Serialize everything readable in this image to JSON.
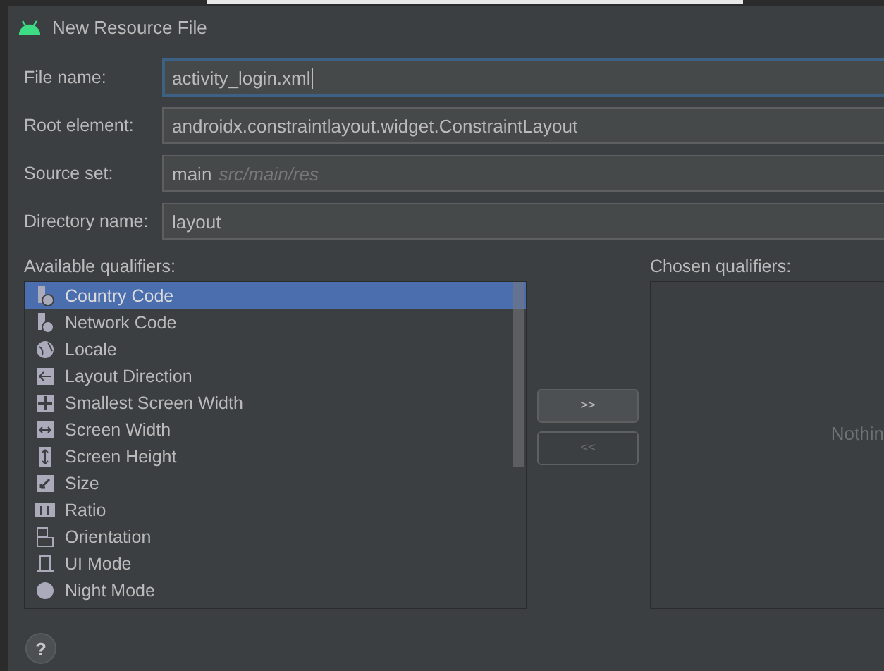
{
  "window": {
    "title": "New Resource File"
  },
  "fields": [
    {
      "label": "File name:",
      "value": "activity_login.xml",
      "focused": true
    },
    {
      "label": "Root element:",
      "value": "androidx.constraintlayout.widget.ConstraintLayout",
      "focused": false
    },
    {
      "label": "Source set:",
      "value": "main",
      "hint": "src/main/res",
      "focused": false
    },
    {
      "label": "Directory name:",
      "value": "layout",
      "focused": false
    }
  ],
  "available": {
    "label": "Available qualifiers:",
    "items": [
      {
        "label": "Country Code",
        "selected": true
      },
      {
        "label": "Network Code",
        "selected": false
      },
      {
        "label": "Locale",
        "selected": false
      },
      {
        "label": "Layout Direction",
        "selected": false
      },
      {
        "label": "Smallest Screen Width",
        "selected": false
      },
      {
        "label": "Screen Width",
        "selected": false
      },
      {
        "label": "Screen Height",
        "selected": false
      },
      {
        "label": "Size",
        "selected": false
      },
      {
        "label": "Ratio",
        "selected": false
      },
      {
        "label": "Orientation",
        "selected": false
      },
      {
        "label": "UI Mode",
        "selected": false
      },
      {
        "label": "Night Mode",
        "selected": false
      }
    ]
  },
  "buttons": [
    {
      "label": ">>",
      "disabled": false
    },
    {
      "label": "<<",
      "disabled": true
    }
  ],
  "chosen": {
    "label": "Chosen qualifiers:",
    "empty_text": "Nothin"
  },
  "help": {
    "label": "?"
  }
}
